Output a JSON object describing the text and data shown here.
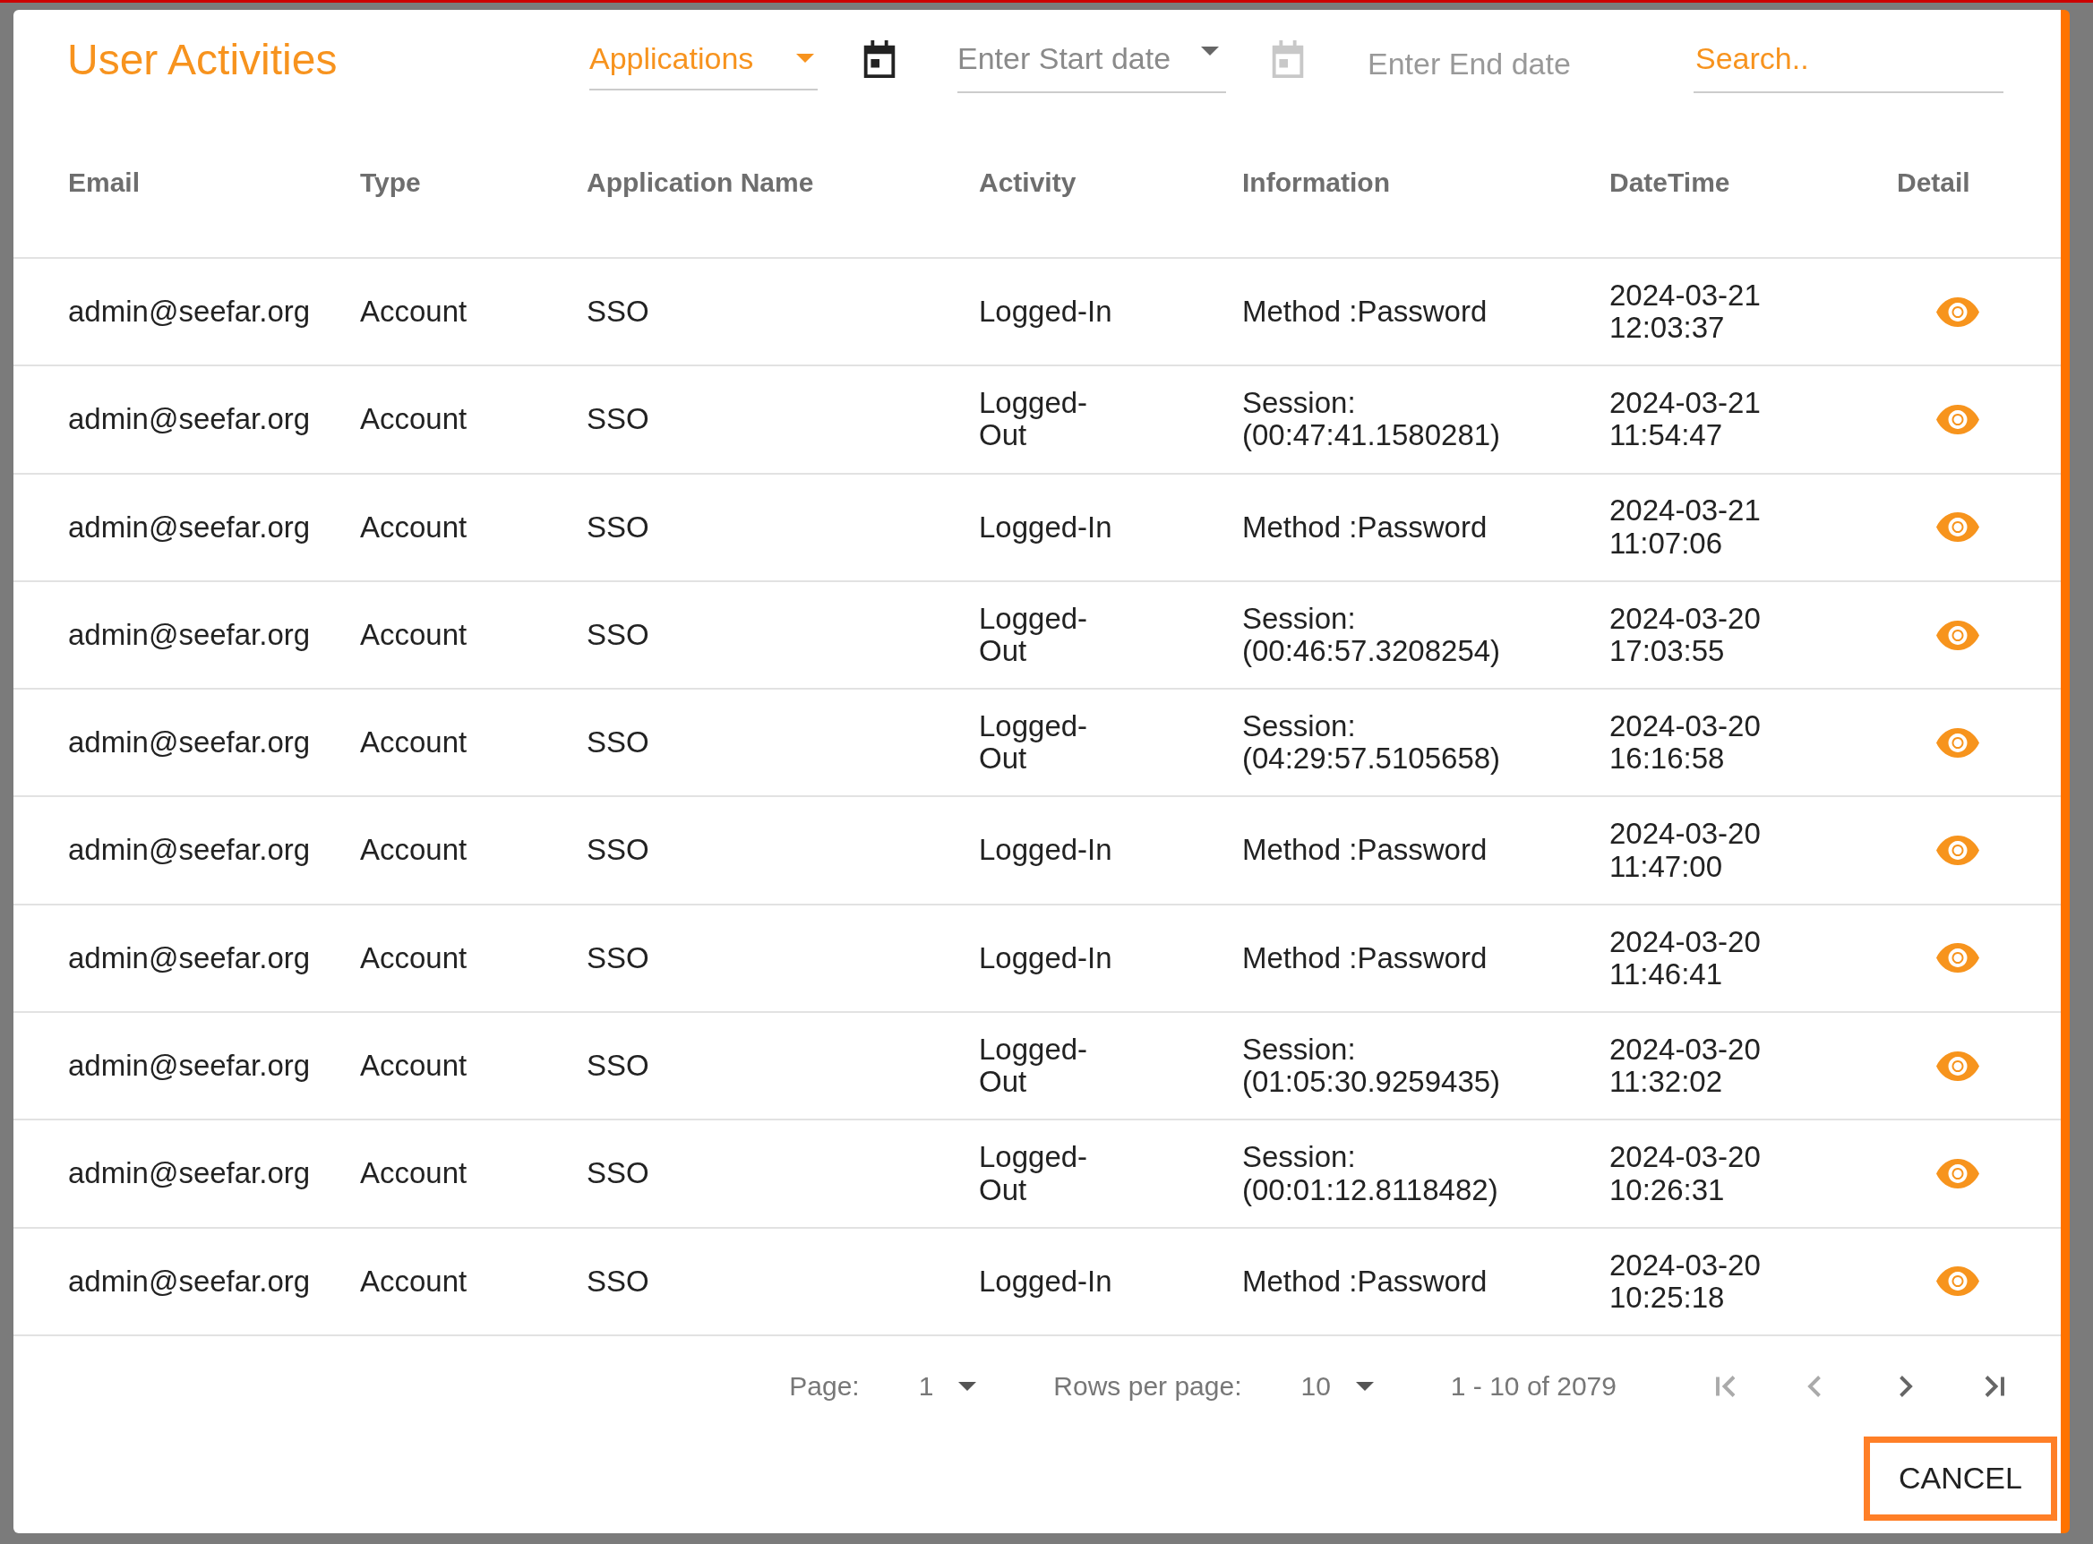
{
  "dialog": {
    "title": "User Activities"
  },
  "filters": {
    "application": {
      "value": "Applications"
    },
    "start_date": {
      "placeholder": "Enter Start date",
      "disabled": false
    },
    "end_date": {
      "placeholder": "Enter End date",
      "disabled": true
    },
    "search": {
      "placeholder": "Search.."
    }
  },
  "table": {
    "columns": [
      "Email",
      "Type",
      "Application Name",
      "Activity",
      "Information",
      "DateTime",
      "Detail"
    ],
    "rows": [
      {
        "email": "admin@seefar.org",
        "type": "Account",
        "application": "SSO",
        "activity": "Logged-In",
        "information": "Method :Password",
        "datetime": "2024-03-21 12:03:37"
      },
      {
        "email": "admin@seefar.org",
        "type": "Account",
        "application": "SSO",
        "activity": "Logged-Out",
        "information": "Session: (00:47:41.1580281)",
        "datetime": "2024-03-21 11:54:47"
      },
      {
        "email": "admin@seefar.org",
        "type": "Account",
        "application": "SSO",
        "activity": "Logged-In",
        "information": "Method :Password",
        "datetime": "2024-03-21 11:07:06"
      },
      {
        "email": "admin@seefar.org",
        "type": "Account",
        "application": "SSO",
        "activity": "Logged-Out",
        "information": "Session: (00:46:57.3208254)",
        "datetime": "2024-03-20 17:03:55"
      },
      {
        "email": "admin@seefar.org",
        "type": "Account",
        "application": "SSO",
        "activity": "Logged-Out",
        "information": "Session: (04:29:57.5105658)",
        "datetime": "2024-03-20 16:16:58"
      },
      {
        "email": "admin@seefar.org",
        "type": "Account",
        "application": "SSO",
        "activity": "Logged-In",
        "information": "Method :Password",
        "datetime": "2024-03-20 11:47:00"
      },
      {
        "email": "admin@seefar.org",
        "type": "Account",
        "application": "SSO",
        "activity": "Logged-In",
        "information": "Method :Password",
        "datetime": "2024-03-20 11:46:41"
      },
      {
        "email": "admin@seefar.org",
        "type": "Account",
        "application": "SSO",
        "activity": "Logged-Out",
        "information": "Session: (01:05:30.9259435)",
        "datetime": "2024-03-20 11:32:02"
      },
      {
        "email": "admin@seefar.org",
        "type": "Account",
        "application": "SSO",
        "activity": "Logged-Out",
        "information": "Session: (00:01:12.8118482)",
        "datetime": "2024-03-20 10:26:31"
      },
      {
        "email": "admin@seefar.org",
        "type": "Account",
        "application": "SSO",
        "activity": "Logged-In",
        "information": "Method :Password",
        "datetime": "2024-03-20 10:25:18"
      }
    ]
  },
  "pagination": {
    "page_label": "Page:",
    "page": "1",
    "rows_label": "Rows per page:",
    "rows_per_page": "10",
    "range": "1 - 10 of 2079",
    "nav": [
      {
        "kind": "first",
        "disabled": true
      },
      {
        "kind": "prev",
        "disabled": true
      },
      {
        "kind": "next",
        "disabled": false
      },
      {
        "kind": "last",
        "disabled": false
      }
    ]
  },
  "cancel_button": "CANCEL"
}
